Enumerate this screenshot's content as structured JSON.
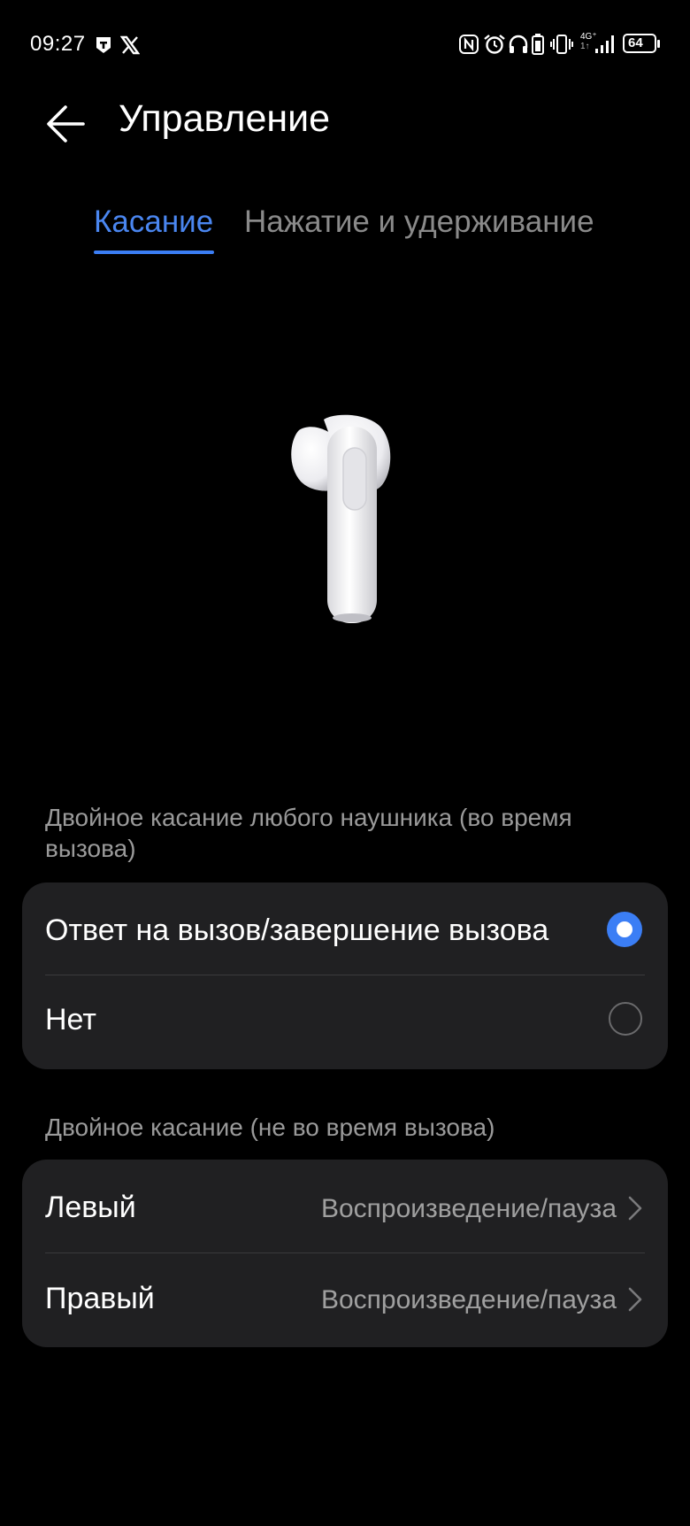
{
  "status_bar": {
    "time": "09:27",
    "battery": "64",
    "network": "4G⁺",
    "network_sub": "1↑",
    "left_icons": [
      "notification-icon",
      "x-logo-icon"
    ],
    "right_icons": [
      "nfc-icon",
      "alarm-icon",
      "headphones-icon",
      "earbud-battery-icon",
      "vibrate-icon",
      "signal-icon",
      "battery-icon"
    ]
  },
  "header": {
    "title": "Управление",
    "back_icon": "arrow-left-icon"
  },
  "tabs": [
    {
      "label": "Касание",
      "active": true
    },
    {
      "label": "Нажатие и удерживание",
      "active": false
    }
  ],
  "section_call": {
    "label_line1": "Двойное касание любого наушника (во время",
    "label_line2": "вызова)",
    "options": [
      {
        "label": "Ответ на вызов/завершение вызова",
        "selected": true
      },
      {
        "label": "Нет",
        "selected": false
      }
    ]
  },
  "section_no_call": {
    "label": "Двойное касание (не во время вызова)",
    "rows": [
      {
        "label": "Левый",
        "value": "Воспроизведение/пауза"
      },
      {
        "label": "Правый",
        "value": "Воспроизведение/пауза"
      }
    ]
  },
  "colors": {
    "accent": "#3b7ef5",
    "background": "#000000",
    "card": "#202022",
    "secondary_text": "#9a9a9a"
  }
}
